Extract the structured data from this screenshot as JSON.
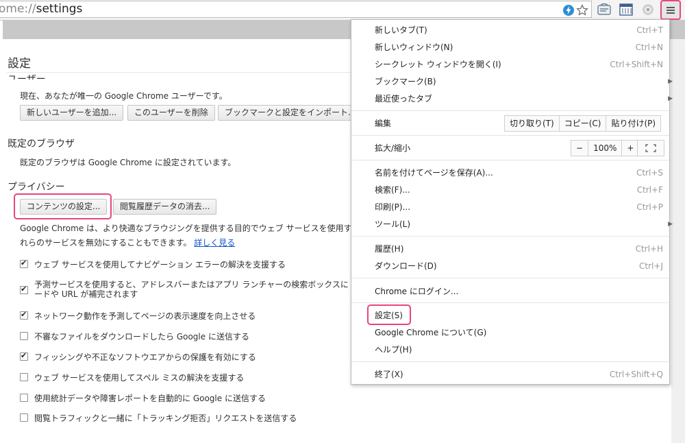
{
  "omnibox": {
    "url_scheme": "ome://",
    "url_path": "settings"
  },
  "settings": {
    "page_title": "設定",
    "users": {
      "title": "ユーザー",
      "description": "現在、あなたが唯一の Google Chrome ユーザーです。",
      "buttons": [
        "新しいユーザーを追加...",
        "このユーザーを削除",
        "ブックマークと設定をインポート..."
      ]
    },
    "default_browser": {
      "title": "既定のブラウザ",
      "description": "既定のブラウザは Google Chrome に設定されています。"
    },
    "privacy": {
      "title": "プライバシー",
      "content_settings_button": "コンテンツの設定...",
      "clear_data_button": "閲覧履歴データの消去...",
      "description_line1": "Google Chrome は、より快適なブラウジングを提供する目的でウェブ サービスを使用する",
      "description_line2": "れらのサービスを無効にすることもできます。",
      "learn_more": "詳しく見る",
      "options": [
        {
          "label": "ウェブ サービスを使用してナビゲーション エラーの解決を支援する",
          "checked": true
        },
        {
          "label": "予測サービスを使用すると、アドレスバーまたはアプリ ランチャーの検索ボックスに",
          "label2": "ードや URL が補完されます",
          "checked": true
        },
        {
          "label": "ネットワーク動作を予測してページの表示速度を向上させる",
          "checked": true
        },
        {
          "label": "不審なファイルをダウンロードしたら Google に送信する",
          "checked": false
        },
        {
          "label": "フィッシングや不正なソフトウエアからの保護を有効にする",
          "checked": true
        },
        {
          "label": "ウェブ サービスを使用してスペル ミスの解決を支援する",
          "checked": false
        },
        {
          "label": "使用統計データや障害レポートを自動的に Google に送信する",
          "checked": false
        },
        {
          "label": "閲覧トラフィックと一緒に「トラッキング拒否」リクエストを送信する",
          "checked": false
        }
      ]
    }
  },
  "menu": {
    "new_tab": {
      "label": "新しいタブ(T)",
      "shortcut": "Ctrl+T"
    },
    "new_window": {
      "label": "新しいウィンドウ(N)",
      "shortcut": "Ctrl+N"
    },
    "incognito": {
      "label": "シークレット ウィンドウを開く(I)",
      "shortcut": "Ctrl+Shift+N"
    },
    "bookmarks": {
      "label": "ブックマーク(B)"
    },
    "recent_tabs": {
      "label": "最近使ったタブ"
    },
    "edit": {
      "label": "編集",
      "cut": "切り取り(T)",
      "copy": "コピー(C)",
      "paste": "貼り付け(P)"
    },
    "zoom": {
      "label": "拡大/縮小",
      "minus": "−",
      "value": "100%",
      "plus": "+"
    },
    "save_page": {
      "label": "名前を付けてページを保存(A)...",
      "shortcut": "Ctrl+S"
    },
    "find": {
      "label": "検索(F)...",
      "shortcut": "Ctrl+F"
    },
    "print": {
      "label": "印刷(P)...",
      "shortcut": "Ctrl+P"
    },
    "tools": {
      "label": "ツール(L)"
    },
    "history": {
      "label": "履歴(H)",
      "shortcut": "Ctrl+H"
    },
    "downloads": {
      "label": "ダウンロード(D)",
      "shortcut": "Ctrl+J"
    },
    "sign_in": {
      "label": "Chrome にログイン..."
    },
    "settings": {
      "label": "設定(S)"
    },
    "about": {
      "label": "Google Chrome について(G)"
    },
    "help": {
      "label": "ヘルプ(H)"
    },
    "exit": {
      "label": "終了(X)",
      "shortcut": "Ctrl+Shift+Q"
    }
  },
  "colors": {
    "highlight": "#e8457a",
    "link": "#1155cc"
  }
}
